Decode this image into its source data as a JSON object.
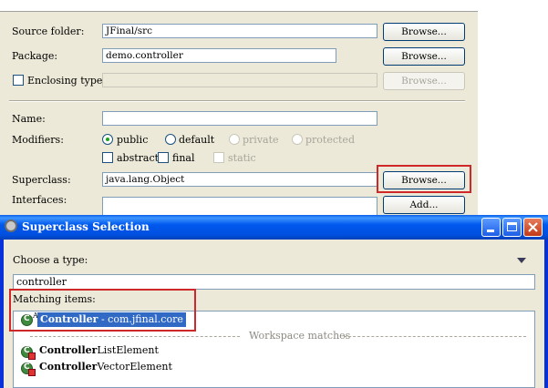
{
  "wizard": {
    "source_folder": {
      "label": "Source folder:",
      "value": "JFinal/src",
      "browse": "Browse..."
    },
    "package": {
      "label": "Package:",
      "value": "demo.controller",
      "browse": "Browse..."
    },
    "enclosing": {
      "label": "Enclosing type:",
      "browse": "Browse..."
    },
    "name": {
      "label": "Name:",
      "value": ""
    },
    "modifiers": {
      "label": "Modifiers:",
      "public": "public",
      "default": "default",
      "private": "private",
      "protected": "protected",
      "abstract": "abstract",
      "final": "final",
      "static": "static"
    },
    "superclass": {
      "label": "Superclass:",
      "value": "java.lang.Object",
      "browse": "Browse..."
    },
    "interfaces": {
      "label": "Interfaces:",
      "add": "Add..."
    }
  },
  "dialog": {
    "title": "Superclass Selection",
    "choose_label": "Choose a type:",
    "search_value": "controller",
    "matching_label": "Matching items:",
    "items": [
      {
        "bold": "Controller",
        "rest": " - com.jfinal.core"
      },
      {
        "bold": "Controller",
        "rest": "ListElement"
      },
      {
        "bold": "Controller",
        "rest": "VectorElement"
      }
    ],
    "workspace_divider": "Workspace matches"
  },
  "colors": {
    "highlight": "#d02828",
    "selection": "#316ac5",
    "titlebar": "#0058ee"
  }
}
